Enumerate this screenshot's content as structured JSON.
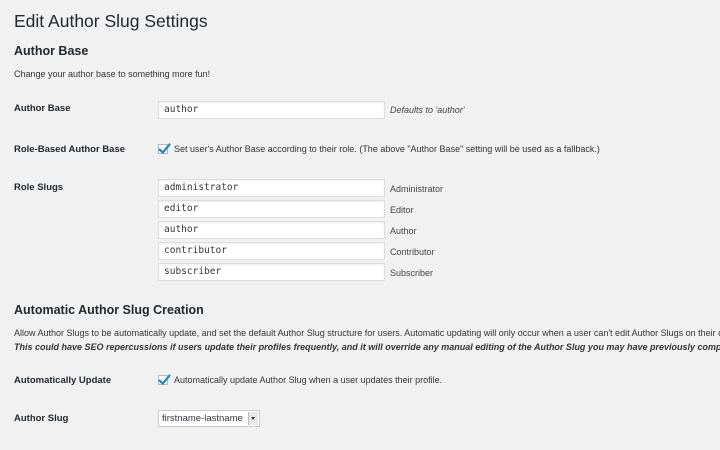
{
  "page": {
    "title": "Edit Author Slug Settings"
  },
  "author_base_section": {
    "heading": "Author Base",
    "description": "Change your author base to something more fun!",
    "author_base": {
      "label": "Author Base",
      "value": "author",
      "hint": "Defaults to 'author'"
    },
    "role_based": {
      "label": "Role-Based Author Base",
      "checked": true,
      "text": "Set user's Author Base according to their role. (The above \"Author Base\" setting will be used as a fallback.)"
    },
    "role_slugs": {
      "label": "Role Slugs",
      "items": [
        {
          "value": "administrator",
          "role": "Administrator"
        },
        {
          "value": "editor",
          "role": "Editor"
        },
        {
          "value": "author",
          "role": "Author"
        },
        {
          "value": "contributor",
          "role": "Contributor"
        },
        {
          "value": "subscriber",
          "role": "Subscriber"
        }
      ]
    }
  },
  "auto_slug_section": {
    "heading": "Automatic Author Slug Creation",
    "description": "Allow Author Slugs to be automatically update, and set the default Author Slug structure for users. Automatic updating will only occur when a user can't edit Author Slugs on their o",
    "warning": "This could have SEO repercussions if users update their profiles frequently, and it will override any manual editing of the Author Slug you may have previously completed.",
    "auto_update": {
      "label": "Automatically Update",
      "checked": true,
      "text": "Automatically update Author Slug when a user updates their profile."
    },
    "author_slug": {
      "label": "Author Slug",
      "selected": "firstname-lastname"
    }
  },
  "colors": {
    "background": "#f1f1f1",
    "checkmark": "#1e8cbe",
    "heading": "#23282d"
  }
}
